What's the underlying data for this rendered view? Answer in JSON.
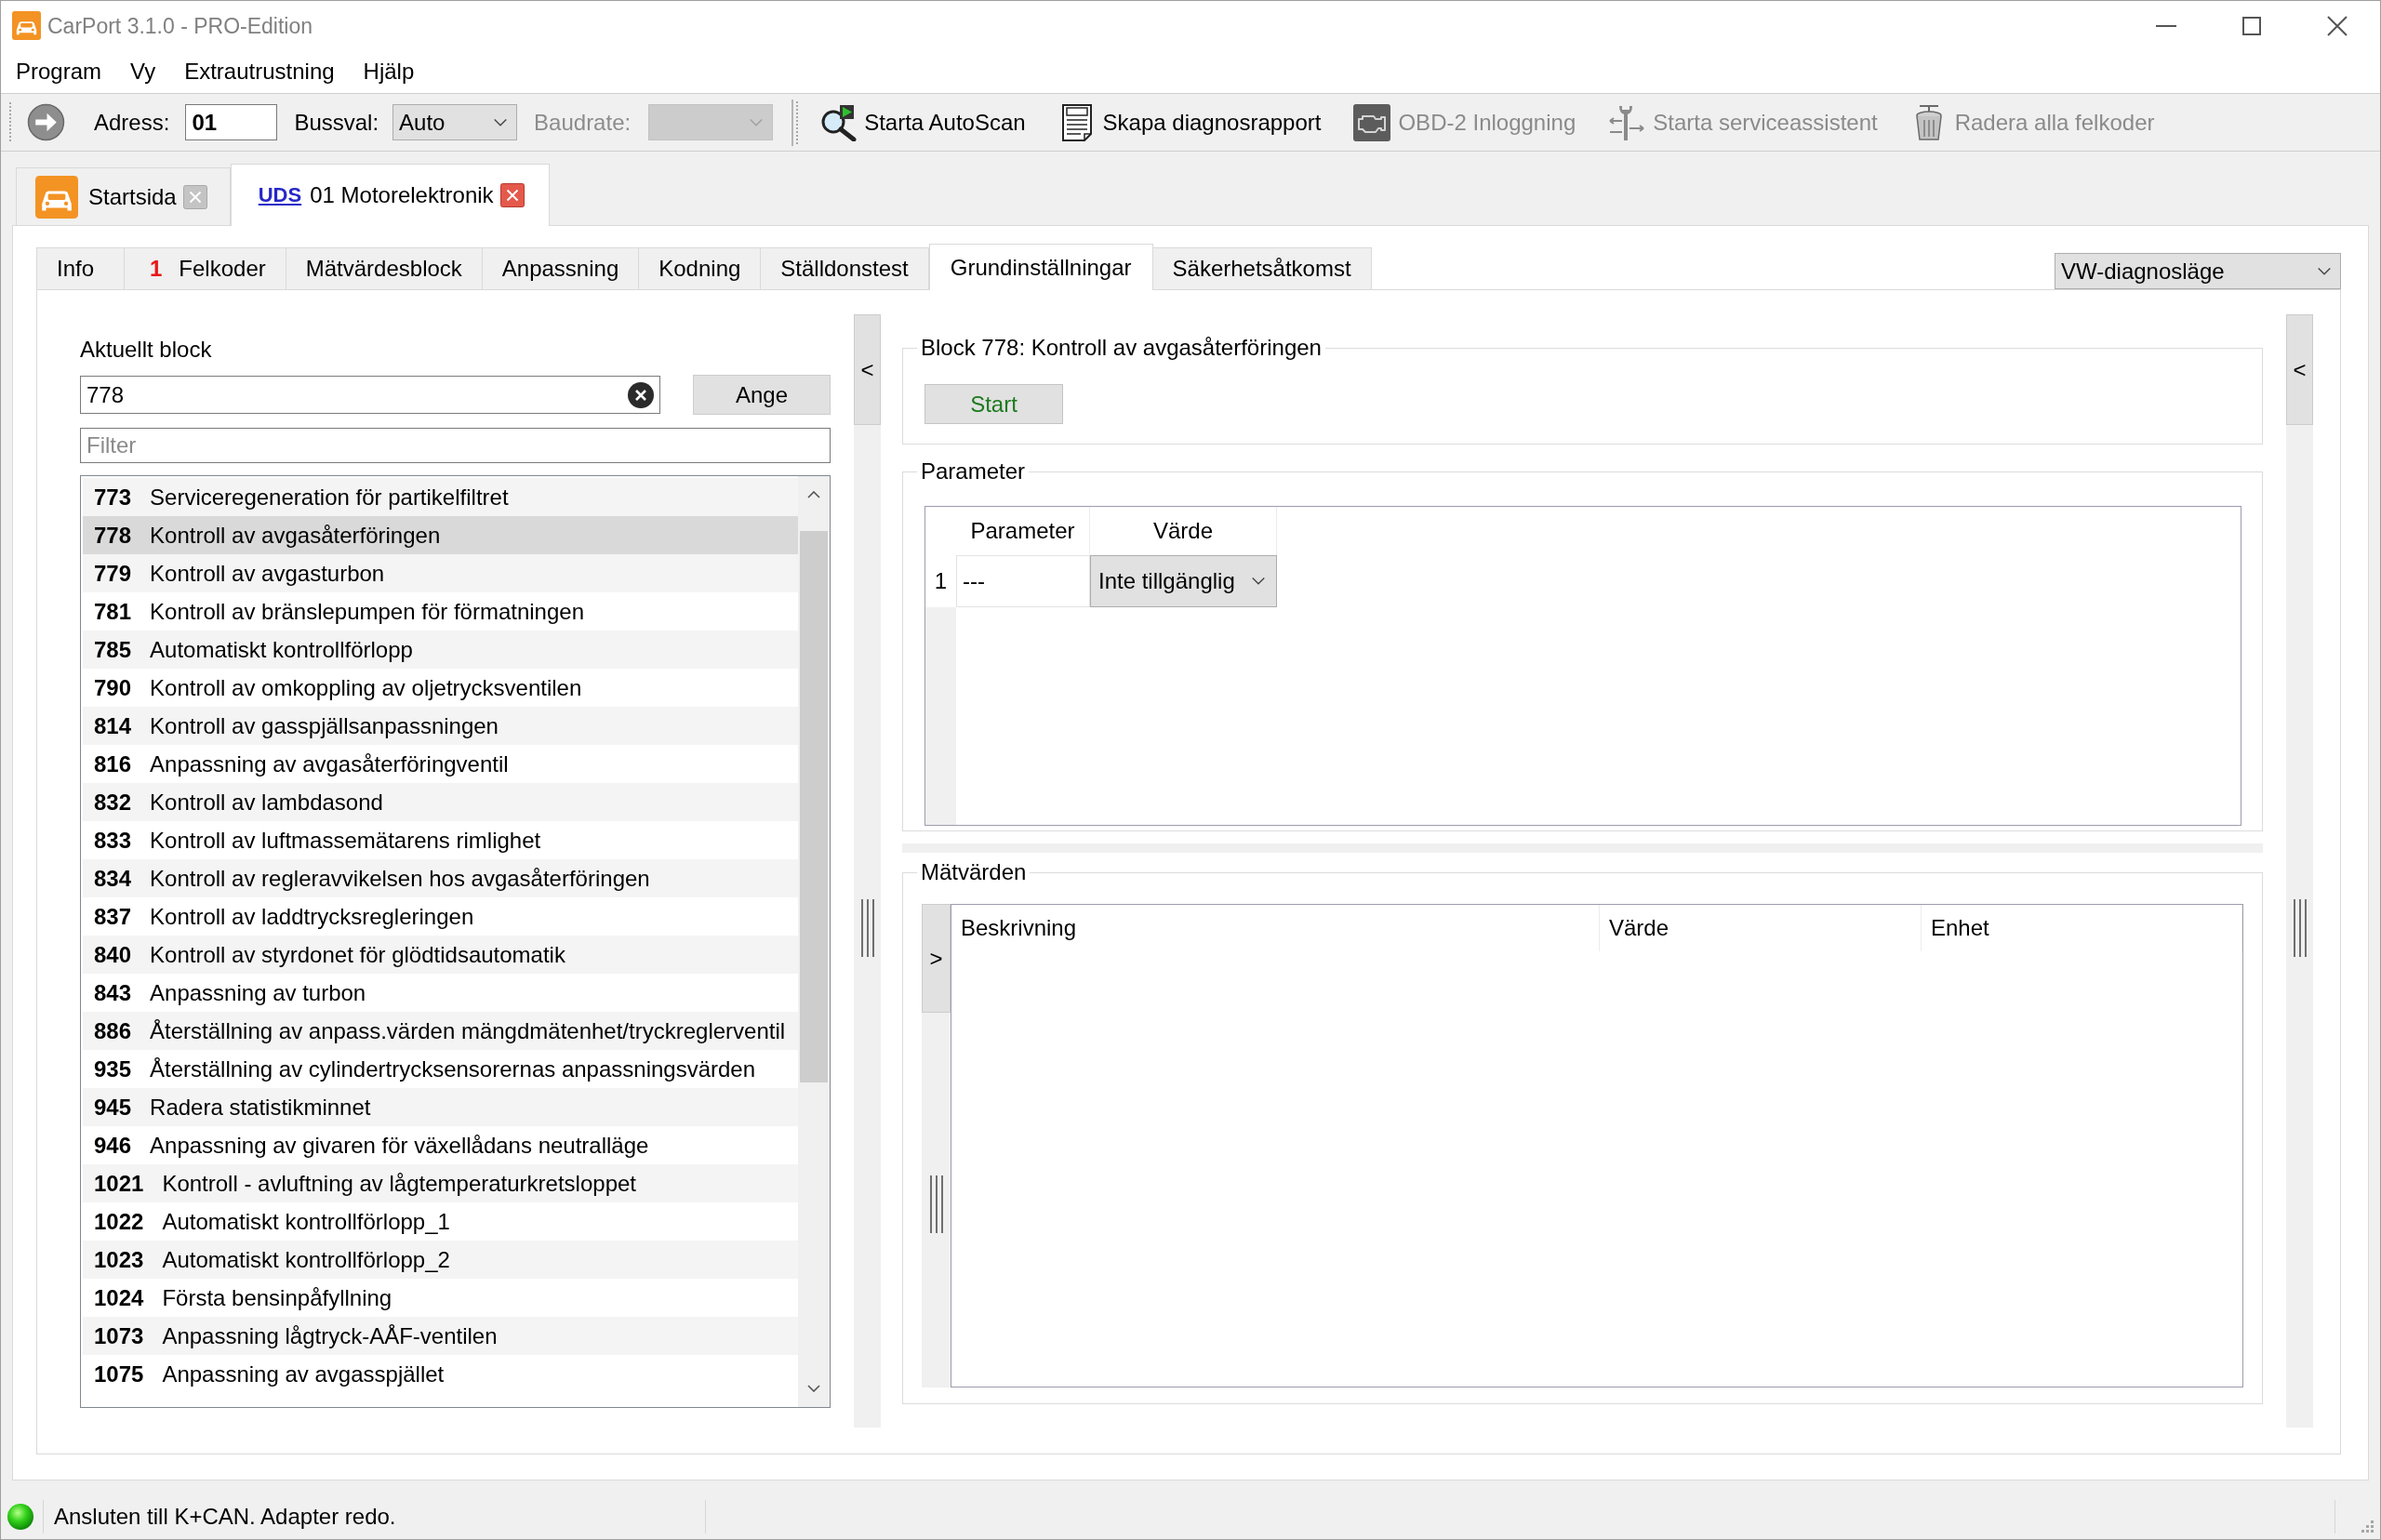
{
  "window": {
    "title": "CarPort 3.1.0 - PRO-Edition"
  },
  "menu": [
    "Program",
    "Vy",
    "Extrautrustning",
    "Hjälp"
  ],
  "toolbar": {
    "address": {
      "label": "Adress:",
      "value": "01"
    },
    "bus": {
      "label": "Bussval:",
      "value": "Auto"
    },
    "baudrate": {
      "label": "Baudrate:",
      "disabled": true
    },
    "actions": [
      {
        "label": "Starta AutoScan",
        "disabled": false
      },
      {
        "label": "Skapa diagnosrapport",
        "disabled": false
      },
      {
        "label": "OBD-2 Inloggning",
        "disabled": true
      },
      {
        "label": "Starta serviceassistent",
        "disabled": true
      },
      {
        "label": "Radera alla felkoder",
        "disabled": true
      }
    ]
  },
  "document_tabs": [
    {
      "kind": "home",
      "label": "Startsida",
      "selected": false
    },
    {
      "kind": "module",
      "protocol": "UDS",
      "label": "01 Motorelektronik",
      "selected": true
    }
  ],
  "function_tabs": [
    {
      "label": "Info",
      "selected": false
    },
    {
      "label": "Felkoder",
      "count": "1",
      "selected": false
    },
    {
      "label": "Mätvärdesblock",
      "selected": false
    },
    {
      "label": "Anpassning",
      "selected": false
    },
    {
      "label": "Kodning",
      "selected": false
    },
    {
      "label": "Ställdonstest",
      "selected": false
    },
    {
      "label": "Grundinställningar",
      "selected": true
    },
    {
      "label": "Säkerhetsåtkomst",
      "selected": false
    }
  ],
  "mode_select": {
    "value": "VW-diagnosläge"
  },
  "block_panel": {
    "label": "Aktuellt block",
    "value": "778",
    "button": "Ange",
    "filter": {
      "placeholder": "Filter"
    },
    "items": [
      {
        "number": "773",
        "name": "Serviceregeneration för partikelfiltret",
        "selected": false
      },
      {
        "number": "778",
        "name": "Kontroll av avgasåterföringen",
        "selected": true
      },
      {
        "number": "779",
        "name": "Kontroll av avgasturbon",
        "selected": false
      },
      {
        "number": "781",
        "name": "Kontroll av bränslepumpen för förmatningen",
        "selected": false
      },
      {
        "number": "785",
        "name": "Automatiskt kontrollförlopp",
        "selected": false
      },
      {
        "number": "790",
        "name": "Kontroll av omkoppling av oljetrycksventilen",
        "selected": false
      },
      {
        "number": "814",
        "name": "Kontroll av gasspjällsanpassningen",
        "selected": false
      },
      {
        "number": "816",
        "name": "Anpassning av avgasåterföringventil",
        "selected": false
      },
      {
        "number": "832",
        "name": "Kontroll av lambdasond",
        "selected": false
      },
      {
        "number": "833",
        "name": "Kontroll av luftmassemätarens rimlighet",
        "selected": false
      },
      {
        "number": "834",
        "name": "Kontroll av regleravvikelsen hos avgasåterföringen",
        "selected": false
      },
      {
        "number": "837",
        "name": "Kontroll av laddtrycksregleringen",
        "selected": false
      },
      {
        "number": "840",
        "name": "Kontroll av styrdonet för glödtidsautomatik",
        "selected": false
      },
      {
        "number": "843",
        "name": "Anpassning av turbon",
        "selected": false
      },
      {
        "number": "886",
        "name": "Återställning av anpass.värden mängdmätenhet/tryckreglerventil",
        "selected": false
      },
      {
        "number": "935",
        "name": "Återställning av cylindertrycksensorernas anpassningsvärden",
        "selected": false
      },
      {
        "number": "945",
        "name": "Radera statistikminnet",
        "selected": false
      },
      {
        "number": "946",
        "name": "Anpassning av givaren för växellådans neutralläge",
        "selected": false
      },
      {
        "number": "1021",
        "name": "Kontroll - avluftning av lågtemperaturkretsloppet",
        "selected": false
      },
      {
        "number": "1022",
        "name": "Automatiskt kontrollförlopp_1",
        "selected": false
      },
      {
        "number": "1023",
        "name": "Automatiskt kontrollförlopp_2",
        "selected": false
      },
      {
        "number": "1024",
        "name": "Första bensinpåfyllning",
        "selected": false
      },
      {
        "number": "1073",
        "name": "Anpassning lågtryck-AÅF-ventilen",
        "selected": false
      },
      {
        "number": "1075",
        "name": "Anpassning av avgasspjället",
        "selected": false
      }
    ]
  },
  "left_splitter": {
    "toggle": "<"
  },
  "block_group": {
    "title": "Block 778: Kontroll av avgasåterföringen",
    "button": "Start"
  },
  "parameters": {
    "title": "Parameter",
    "columns": [
      "Parameter",
      "Värde"
    ],
    "rows": [
      {
        "number": "1",
        "parameter": "---",
        "value": "Inte tillgänglig"
      }
    ]
  },
  "measurements": {
    "title": "Mätvärden",
    "toggle": ">",
    "columns": [
      "Beskrivning",
      "Värde",
      "Enhet"
    ]
  },
  "right_splitter": {
    "toggle": "<"
  },
  "status_bar": {
    "text": "Ansluten till K+CAN. Adapter redo.",
    "connected": true
  }
}
